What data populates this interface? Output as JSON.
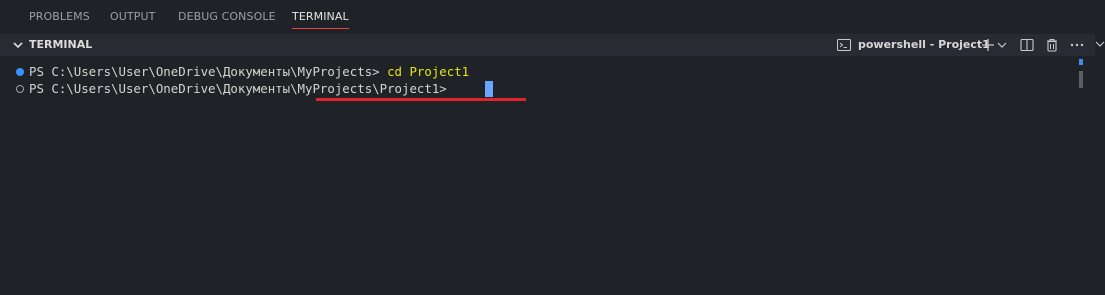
{
  "tabs": [
    {
      "label": "PROBLEMS",
      "active": false
    },
    {
      "label": "OUTPUT",
      "active": false
    },
    {
      "label": "DEBUG CONSOLE",
      "active": false
    },
    {
      "label": "TERMINAL",
      "active": true
    }
  ],
  "section": {
    "title": "TERMINAL",
    "terminal_name": "powershell - Project1",
    "icons": [
      "terminal-icon",
      "add-icon",
      "chevron-down-icon",
      "split-icon",
      "trash-icon",
      "more-icon"
    ]
  },
  "terminal": {
    "lines": [
      {
        "prompt": "PS C:\\Users\\User\\OneDrive\\Документы\\MyProjects> ",
        "command": "cd Project1",
        "status": "success"
      },
      {
        "prompt": "PS C:\\Users\\User\\OneDrive\\Документы\\MyProjects\\Project1> ",
        "command": "",
        "status": "default"
      }
    ]
  },
  "colors": {
    "background": "#1f2226",
    "header": "#282b31",
    "accent_underline": "#e0252a",
    "command": "#e5e510",
    "success_dot": "#3794ff",
    "cursor": "#6aa6ff"
  }
}
